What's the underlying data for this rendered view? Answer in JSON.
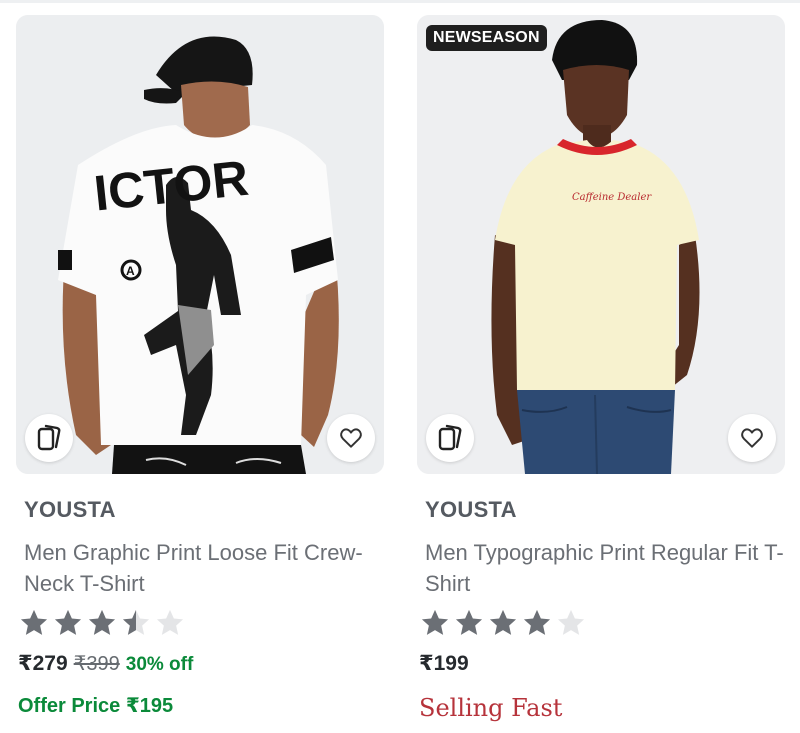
{
  "products": [
    {
      "badge": "",
      "brand": "YOUSTA",
      "title": "Men Graphic Print Loose Fit Crew-Neck T-Shirt",
      "rating": 3.5,
      "rating_max": 5,
      "price": "₹279",
      "mrp": "₹399",
      "discount": "30% off",
      "offer": "Offer Price ₹195",
      "status": "",
      "image_print_text": "ICTOR",
      "image_desc_icons": [
        "similar-products-icon",
        "wishlist-heart-icon"
      ]
    },
    {
      "badge": "NEWSEASON",
      "brand": "YOUSTA",
      "title": "Men Typographic Print Regular Fit T-Shirt",
      "rating": 4,
      "rating_max": 5,
      "price": "₹199",
      "mrp": "",
      "discount": "",
      "offer": "",
      "status": "Selling Fast",
      "image_print_text": "Caffeine Dealer",
      "image_desc_icons": [
        "similar-products-icon",
        "wishlist-heart-icon"
      ]
    }
  ],
  "colors": {
    "star_filled": "#6b6f75",
    "star_empty": "#e4e5e7",
    "discount_green": "#0b8a3a",
    "selling_red": "#b6333b",
    "badge_bg": "#1f1f1f"
  }
}
